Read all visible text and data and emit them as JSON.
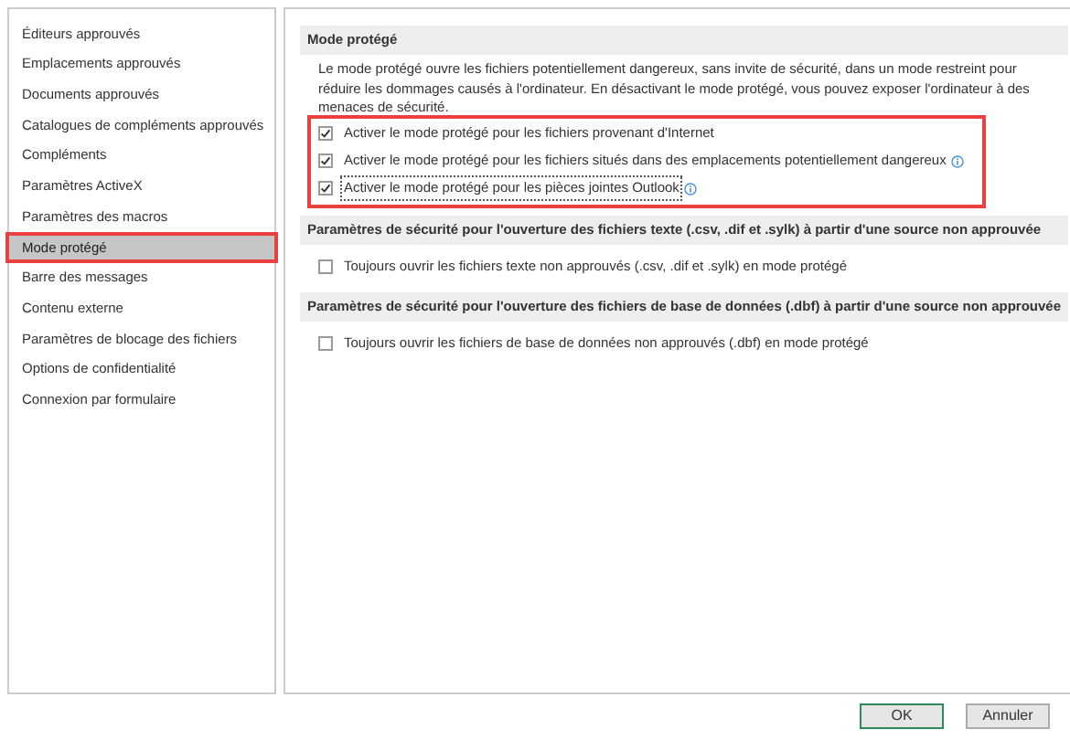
{
  "sidebar": {
    "items": [
      {
        "label": "Éditeurs approuvés",
        "selected": false
      },
      {
        "label": "Emplacements approuvés",
        "selected": false
      },
      {
        "label": "Documents approuvés",
        "selected": false
      },
      {
        "label": "Catalogues de compléments approuvés",
        "selected": false
      },
      {
        "label": "Compléments",
        "selected": false
      },
      {
        "label": "Paramètres ActiveX",
        "selected": false
      },
      {
        "label": "Paramètres des macros",
        "selected": false
      },
      {
        "label": "Mode protégé",
        "selected": true,
        "highlighted": true
      },
      {
        "label": "Barre des messages",
        "selected": false
      },
      {
        "label": "Contenu externe",
        "selected": false
      },
      {
        "label": "Paramètres de blocage des fichiers",
        "selected": false
      },
      {
        "label": "Options de confidentialité",
        "selected": false
      },
      {
        "label": "Connexion par formulaire",
        "selected": false
      }
    ]
  },
  "sections": [
    {
      "title": "Mode protégé",
      "description": "Le mode protégé ouvre les fichiers potentiellement dangereux, sans invite de sécurité, dans un mode restreint pour réduire les dommages causés à l'ordinateur. En désactivant le mode protégé, vous pouvez exposer l'ordinateur à des menaces de sécurité.",
      "highlighted": true,
      "options": [
        {
          "label": "Activer le mode protégé pour les fichiers provenant d'Internet",
          "checked": true,
          "info": false,
          "focused": false
        },
        {
          "label": "Activer le mode protégé pour les fichiers situés dans des emplacements potentiellement dangereux",
          "checked": true,
          "info": true,
          "focused": false
        },
        {
          "label": "Activer le mode protégé pour les pièces jointes Outlook",
          "checked": true,
          "info": true,
          "focused": true
        }
      ]
    },
    {
      "title": "Paramètres de sécurité pour l'ouverture des fichiers texte (.csv, .dif et .sylk) à partir d'une source non approuvée",
      "highlighted": false,
      "options": [
        {
          "label": "Toujours ouvrir les fichiers texte non approuvés (.csv, .dif et .sylk) en mode protégé",
          "checked": false,
          "info": false,
          "focused": false
        }
      ]
    },
    {
      "title": "Paramètres de sécurité pour l'ouverture des fichiers de base de données (.dbf) à partir d'une source non approuvée",
      "highlighted": false,
      "options": [
        {
          "label": "Toujours ouvrir les fichiers de base de données non approuvés (.dbf) en mode protégé",
          "checked": false,
          "info": false,
          "focused": false
        }
      ]
    }
  ],
  "buttons": [
    {
      "label": "OK",
      "default": true
    },
    {
      "label": "Annuler",
      "default": false
    }
  ]
}
